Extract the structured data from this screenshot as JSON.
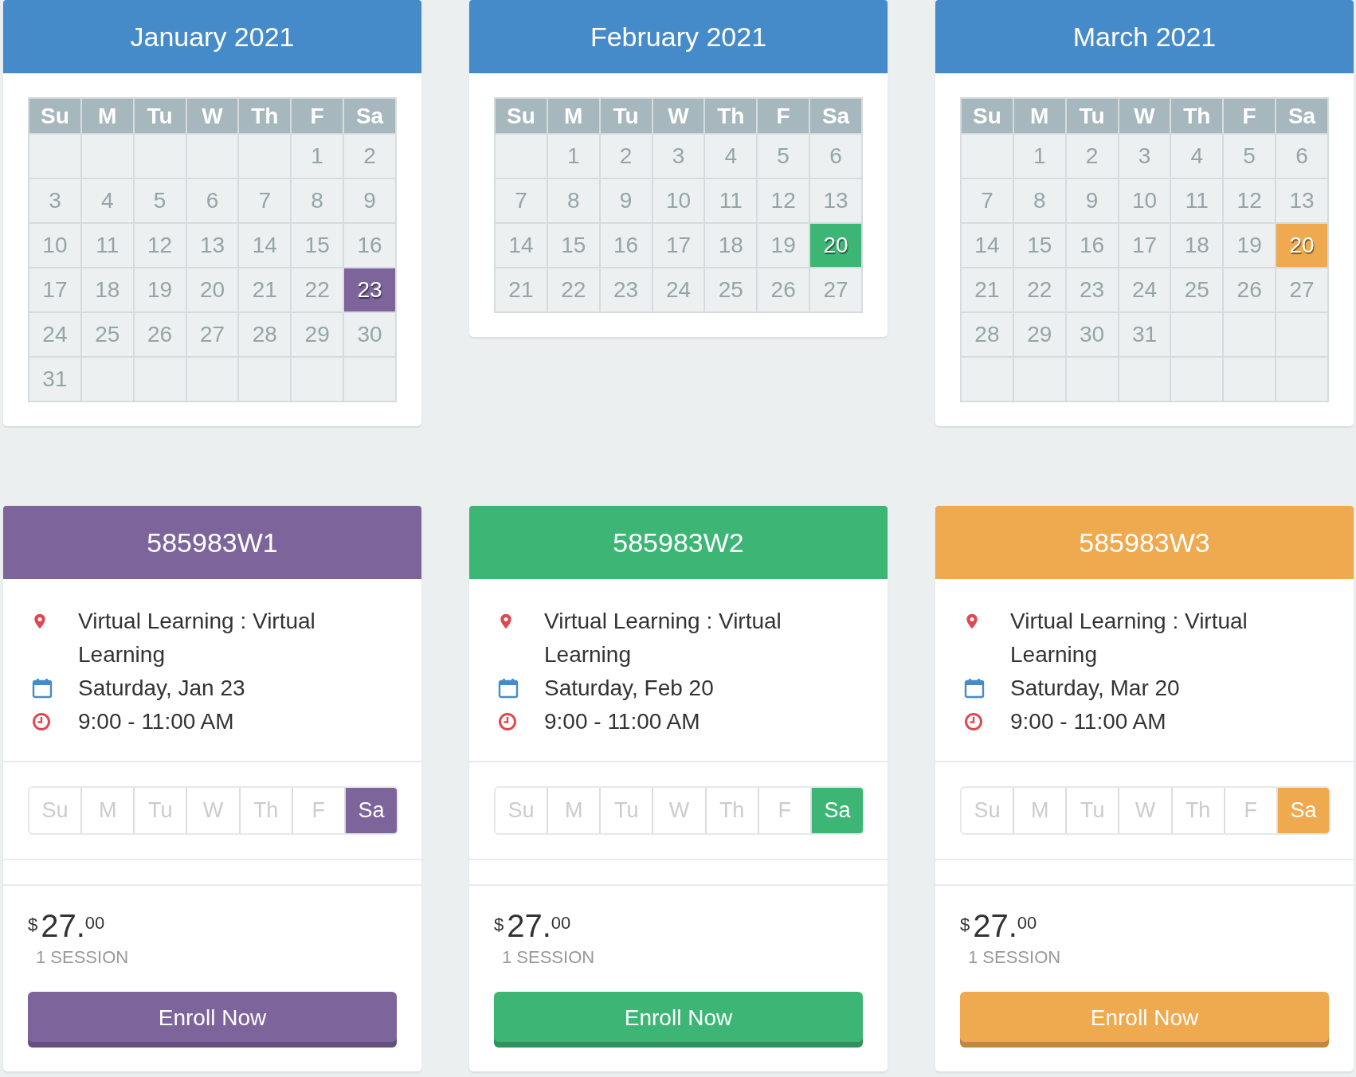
{
  "calendars": [
    {
      "title": "January 2021",
      "color": "#7d659c",
      "weekdays": [
        "Su",
        "M",
        "Tu",
        "W",
        "Th",
        "F",
        "Sa"
      ],
      "weeks": [
        [
          {
            "kind": "blank"
          },
          {
            "kind": "blank"
          },
          {
            "kind": "blank"
          },
          {
            "kind": "blank"
          },
          {
            "kind": "blank"
          },
          {
            "kind": "day",
            "d": "1",
            "selected": false
          },
          {
            "kind": "day",
            "d": "2",
            "selected": false
          }
        ],
        [
          {
            "kind": "day",
            "d": "3",
            "selected": false
          },
          {
            "kind": "day",
            "d": "4",
            "selected": false
          },
          {
            "kind": "day",
            "d": "5",
            "selected": false
          },
          {
            "kind": "day",
            "d": "6",
            "selected": false
          },
          {
            "kind": "day",
            "d": "7",
            "selected": false
          },
          {
            "kind": "day",
            "d": "8",
            "selected": false
          },
          {
            "kind": "day",
            "d": "9",
            "selected": false
          }
        ],
        [
          {
            "kind": "day",
            "d": "10",
            "selected": false
          },
          {
            "kind": "day",
            "d": "11",
            "selected": false
          },
          {
            "kind": "day",
            "d": "12",
            "selected": false
          },
          {
            "kind": "day",
            "d": "13",
            "selected": false
          },
          {
            "kind": "day",
            "d": "14",
            "selected": false
          },
          {
            "kind": "day",
            "d": "15",
            "selected": false
          },
          {
            "kind": "day",
            "d": "16",
            "selected": false
          }
        ],
        [
          {
            "kind": "day",
            "d": "17",
            "selected": false
          },
          {
            "kind": "day",
            "d": "18",
            "selected": false
          },
          {
            "kind": "day",
            "d": "19",
            "selected": false
          },
          {
            "kind": "day",
            "d": "20",
            "selected": false
          },
          {
            "kind": "day",
            "d": "21",
            "selected": false
          },
          {
            "kind": "day",
            "d": "22",
            "selected": false
          },
          {
            "kind": "day",
            "d": "23",
            "selected": true
          }
        ],
        [
          {
            "kind": "day",
            "d": "24",
            "selected": false
          },
          {
            "kind": "day",
            "d": "25",
            "selected": false
          },
          {
            "kind": "day",
            "d": "26",
            "selected": false
          },
          {
            "kind": "day",
            "d": "27",
            "selected": false
          },
          {
            "kind": "day",
            "d": "28",
            "selected": false
          },
          {
            "kind": "day",
            "d": "29",
            "selected": false
          },
          {
            "kind": "day",
            "d": "30",
            "selected": false
          }
        ],
        [
          {
            "kind": "day",
            "d": "31",
            "selected": false
          },
          {
            "kind": "blank"
          },
          {
            "kind": "blank"
          },
          {
            "kind": "blank"
          },
          {
            "kind": "blank"
          },
          {
            "kind": "blank"
          },
          {
            "kind": "blank"
          }
        ]
      ]
    },
    {
      "title": "February 2021",
      "color": "#3db675",
      "weekdays": [
        "Su",
        "M",
        "Tu",
        "W",
        "Th",
        "F",
        "Sa"
      ],
      "weeks": [
        [
          {
            "kind": "blank"
          },
          {
            "kind": "day",
            "d": "1",
            "selected": false
          },
          {
            "kind": "day",
            "d": "2",
            "selected": false
          },
          {
            "kind": "day",
            "d": "3",
            "selected": false
          },
          {
            "kind": "day",
            "d": "4",
            "selected": false
          },
          {
            "kind": "day",
            "d": "5",
            "selected": false
          },
          {
            "kind": "day",
            "d": "6",
            "selected": false
          }
        ],
        [
          {
            "kind": "day",
            "d": "7",
            "selected": false
          },
          {
            "kind": "day",
            "d": "8",
            "selected": false
          },
          {
            "kind": "day",
            "d": "9",
            "selected": false
          },
          {
            "kind": "day",
            "d": "10",
            "selected": false
          },
          {
            "kind": "day",
            "d": "11",
            "selected": false
          },
          {
            "kind": "day",
            "d": "12",
            "selected": false
          },
          {
            "kind": "day",
            "d": "13",
            "selected": false
          }
        ],
        [
          {
            "kind": "day",
            "d": "14",
            "selected": false
          },
          {
            "kind": "day",
            "d": "15",
            "selected": false
          },
          {
            "kind": "day",
            "d": "16",
            "selected": false
          },
          {
            "kind": "day",
            "d": "17",
            "selected": false
          },
          {
            "kind": "day",
            "d": "18",
            "selected": false
          },
          {
            "kind": "day",
            "d": "19",
            "selected": false
          },
          {
            "kind": "day",
            "d": "20",
            "selected": true
          }
        ],
        [
          {
            "kind": "day",
            "d": "21",
            "selected": false
          },
          {
            "kind": "day",
            "d": "22",
            "selected": false
          },
          {
            "kind": "day",
            "d": "23",
            "selected": false
          },
          {
            "kind": "day",
            "d": "24",
            "selected": false
          },
          {
            "kind": "day",
            "d": "25",
            "selected": false
          },
          {
            "kind": "day",
            "d": "26",
            "selected": false
          },
          {
            "kind": "day",
            "d": "27",
            "selected": false
          }
        ]
      ]
    },
    {
      "title": "March 2021",
      "color": "#efa94f",
      "weekdays": [
        "Su",
        "M",
        "Tu",
        "W",
        "Th",
        "F",
        "Sa"
      ],
      "weeks": [
        [
          {
            "kind": "blank"
          },
          {
            "kind": "day",
            "d": "1",
            "selected": false
          },
          {
            "kind": "day",
            "d": "2",
            "selected": false
          },
          {
            "kind": "day",
            "d": "3",
            "selected": false
          },
          {
            "kind": "day",
            "d": "4",
            "selected": false
          },
          {
            "kind": "day",
            "d": "5",
            "selected": false
          },
          {
            "kind": "day",
            "d": "6",
            "selected": false
          }
        ],
        [
          {
            "kind": "day",
            "d": "7",
            "selected": false
          },
          {
            "kind": "day",
            "d": "8",
            "selected": false
          },
          {
            "kind": "day",
            "d": "9",
            "selected": false
          },
          {
            "kind": "day",
            "d": "10",
            "selected": false
          },
          {
            "kind": "day",
            "d": "11",
            "selected": false
          },
          {
            "kind": "day",
            "d": "12",
            "selected": false
          },
          {
            "kind": "day",
            "d": "13",
            "selected": false
          }
        ],
        [
          {
            "kind": "day",
            "d": "14",
            "selected": false
          },
          {
            "kind": "day",
            "d": "15",
            "selected": false
          },
          {
            "kind": "day",
            "d": "16",
            "selected": false
          },
          {
            "kind": "day",
            "d": "17",
            "selected": false
          },
          {
            "kind": "day",
            "d": "18",
            "selected": false
          },
          {
            "kind": "day",
            "d": "19",
            "selected": false
          },
          {
            "kind": "day",
            "d": "20",
            "selected": true
          }
        ],
        [
          {
            "kind": "day",
            "d": "21",
            "selected": false
          },
          {
            "kind": "day",
            "d": "22",
            "selected": false
          },
          {
            "kind": "day",
            "d": "23",
            "selected": false
          },
          {
            "kind": "day",
            "d": "24",
            "selected": false
          },
          {
            "kind": "day",
            "d": "25",
            "selected": false
          },
          {
            "kind": "day",
            "d": "26",
            "selected": false
          },
          {
            "kind": "day",
            "d": "27",
            "selected": false
          }
        ],
        [
          {
            "kind": "day",
            "d": "28",
            "selected": false
          },
          {
            "kind": "day",
            "d": "29",
            "selected": false
          },
          {
            "kind": "day",
            "d": "30",
            "selected": false
          },
          {
            "kind": "day",
            "d": "31",
            "selected": false
          },
          {
            "kind": "blank"
          },
          {
            "kind": "blank"
          },
          {
            "kind": "blank"
          }
        ],
        [
          {
            "kind": "blank"
          },
          {
            "kind": "blank"
          },
          {
            "kind": "blank"
          },
          {
            "kind": "blank"
          },
          {
            "kind": "blank"
          },
          {
            "kind": "blank"
          },
          {
            "kind": "blank"
          }
        ]
      ]
    }
  ],
  "sessions": [
    {
      "code": "585983W1",
      "color": "#7d659c",
      "location": "Virtual Learning : Virtual Learning",
      "date": "Saturday, Jan 23",
      "time": "9:00 - 11:00 AM",
      "days": [
        {
          "label": "Su",
          "selected": false
        },
        {
          "label": "M",
          "selected": false
        },
        {
          "label": "Tu",
          "selected": false
        },
        {
          "label": "W",
          "selected": false
        },
        {
          "label": "Th",
          "selected": false
        },
        {
          "label": "F",
          "selected": false
        },
        {
          "label": "Sa",
          "selected": true
        }
      ],
      "price": {
        "currency": "$",
        "whole": "27.",
        "cents": "00"
      },
      "sessions_label": "1 SESSION",
      "button": "Enroll Now"
    },
    {
      "code": "585983W2",
      "color": "#3db675",
      "location": "Virtual Learning : Virtual Learning",
      "date": "Saturday, Feb 20",
      "time": "9:00 - 11:00 AM",
      "days": [
        {
          "label": "Su",
          "selected": false
        },
        {
          "label": "M",
          "selected": false
        },
        {
          "label": "Tu",
          "selected": false
        },
        {
          "label": "W",
          "selected": false
        },
        {
          "label": "Th",
          "selected": false
        },
        {
          "label": "F",
          "selected": false
        },
        {
          "label": "Sa",
          "selected": true
        }
      ],
      "price": {
        "currency": "$",
        "whole": "27.",
        "cents": "00"
      },
      "sessions_label": "1 SESSION",
      "button": "Enroll Now"
    },
    {
      "code": "585983W3",
      "color": "#efa94f",
      "location": "Virtual Learning : Virtual Learning",
      "date": "Saturday, Mar 20",
      "time": "9:00 - 11:00 AM",
      "days": [
        {
          "label": "Su",
          "selected": false
        },
        {
          "label": "M",
          "selected": false
        },
        {
          "label": "Tu",
          "selected": false
        },
        {
          "label": "W",
          "selected": false
        },
        {
          "label": "Th",
          "selected": false
        },
        {
          "label": "F",
          "selected": false
        },
        {
          "label": "Sa",
          "selected": true
        }
      ],
      "price": {
        "currency": "$",
        "whole": "27.",
        "cents": "00"
      },
      "sessions_label": "1 SESSION",
      "button": "Enroll Now"
    }
  ]
}
